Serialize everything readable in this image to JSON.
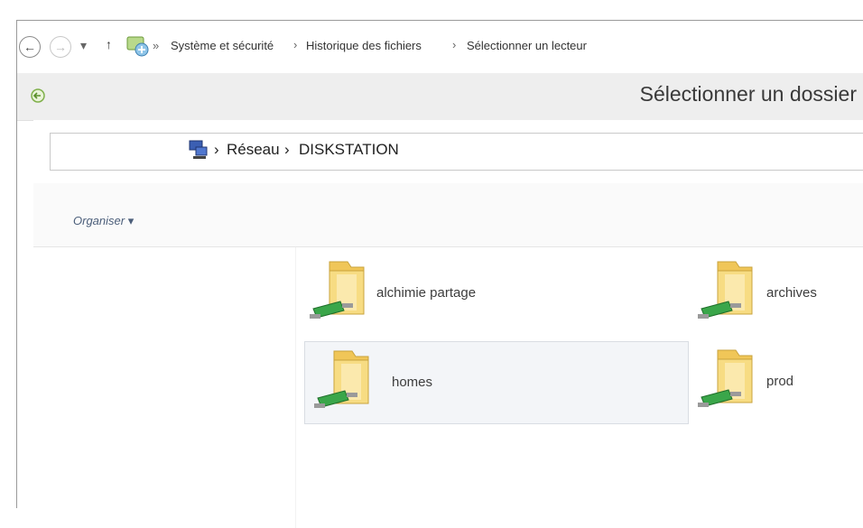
{
  "outer": {
    "back": "←",
    "forward": "→",
    "recent": "▾",
    "up": "↑",
    "breadcrumb_sep": "»",
    "crumbs": [
      "Système et sécurité",
      "Historique des fichiers",
      "Sélectionner un lecteur"
    ],
    "crumb_sep": "›"
  },
  "dialog": {
    "title": "Sélectionner un dossier"
  },
  "inner": {
    "back": "←",
    "forward": "→",
    "recent": "▾",
    "up": "↑",
    "crumbs": [
      "Réseau",
      "DISKSTATION"
    ],
    "crumb_sep": "›"
  },
  "toolbar": {
    "organize": "Organiser ▾"
  },
  "folders": [
    {
      "name": "alchimie partage"
    },
    {
      "name": "archives"
    },
    {
      "name": "homes"
    },
    {
      "name": "prod"
    }
  ],
  "colors": {
    "folder": "#f5d36b",
    "network": "#3aa64a",
    "selection": "#f3f5f8"
  }
}
